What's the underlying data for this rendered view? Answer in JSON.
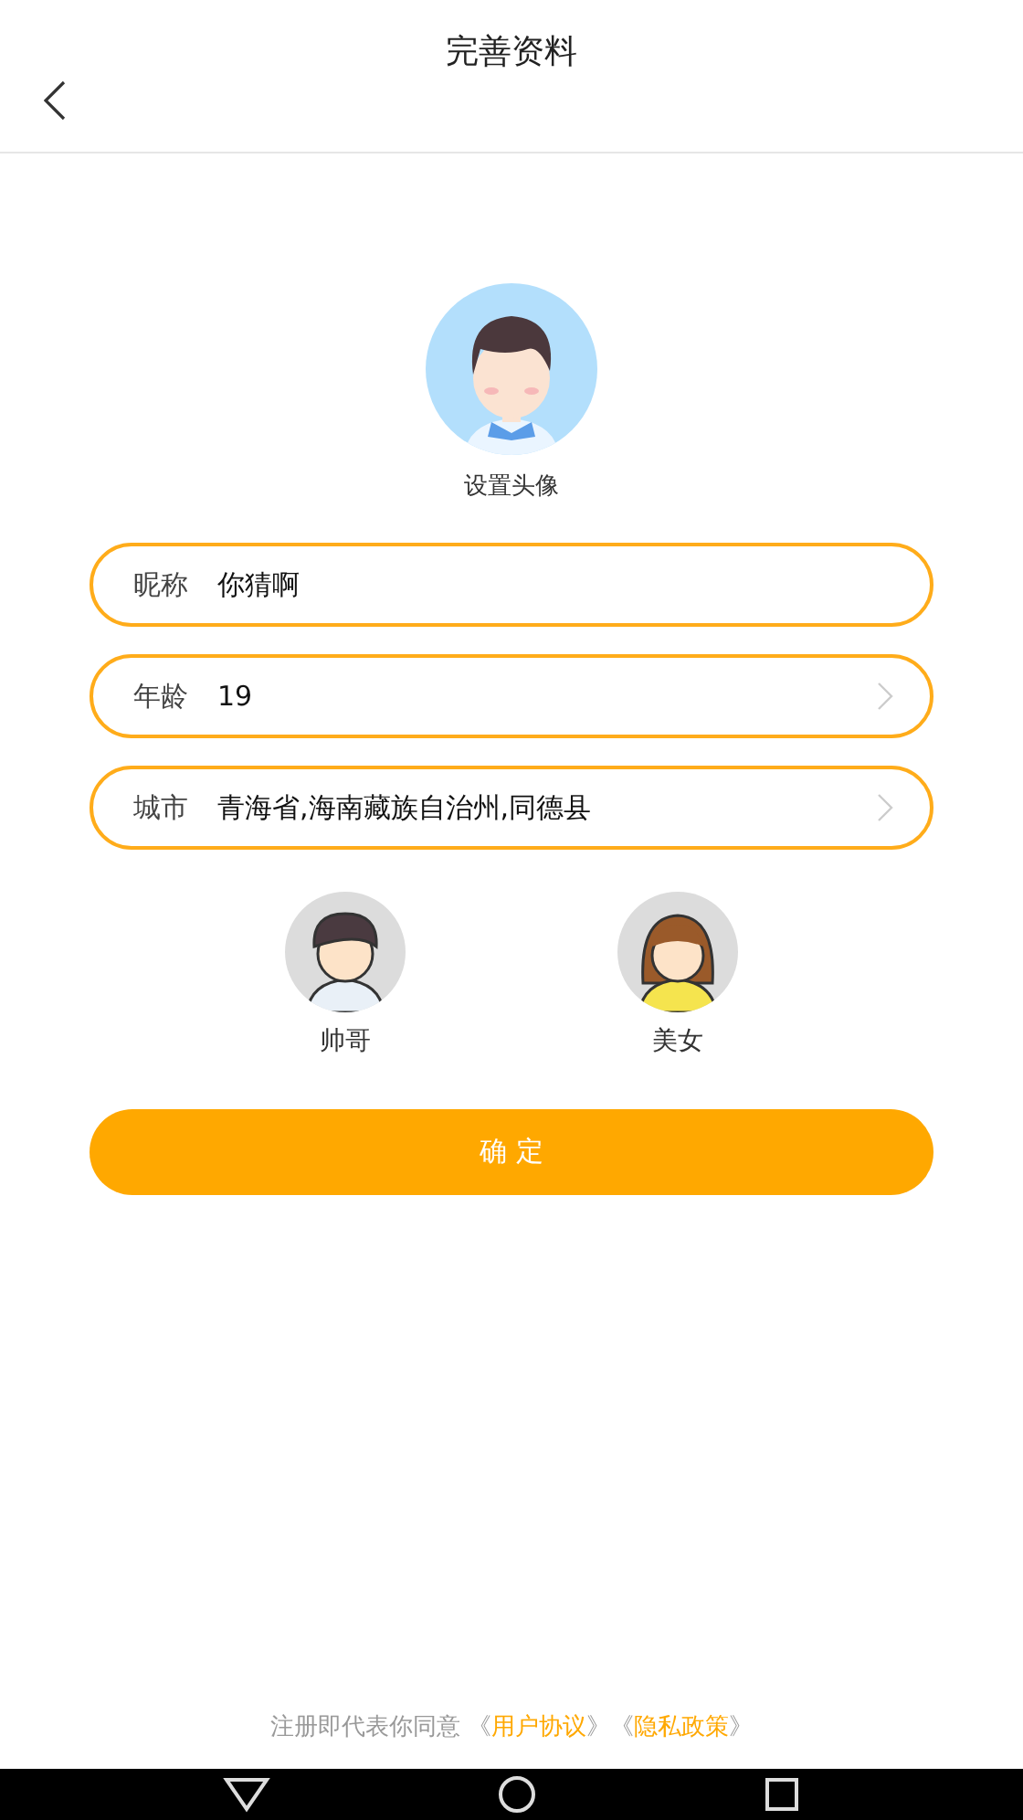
{
  "header": {
    "title": "完善资料"
  },
  "avatar": {
    "label": "设置头像"
  },
  "fields": [
    {
      "kind": "text",
      "label": "昵称",
      "value": "你猜啊"
    },
    {
      "kind": "picker",
      "label": "年龄",
      "value": "19"
    },
    {
      "kind": "picker",
      "label": "城市",
      "value": "青海省,海南藏族自治州,同德县"
    }
  ],
  "genders": [
    {
      "kind": "male",
      "label": "帅哥"
    },
    {
      "kind": "female",
      "label": "美女"
    }
  ],
  "confirm_button": "确 定",
  "footer": {
    "text": "注册即代表你同意",
    "links": [
      {
        "open": "《",
        "label": "用户协议",
        "close": "》"
      },
      {
        "open": "《",
        "label": "隐私政策",
        "close": "》"
      }
    ]
  }
}
